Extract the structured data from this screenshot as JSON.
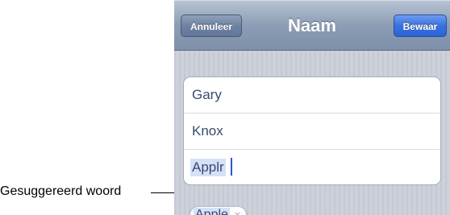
{
  "navbar": {
    "title": "Naam",
    "cancel_label": "Annuleer",
    "save_label": "Bewaar"
  },
  "form": {
    "rows": [
      {
        "value": "Gary"
      },
      {
        "value": "Knox"
      },
      {
        "value": "Applr"
      }
    ]
  },
  "suggestion": {
    "word": "Apple",
    "dismiss_glyph": "×"
  },
  "callout": {
    "label": "Gesuggereerd woord"
  },
  "colors": {
    "navbar": "#8d9db5",
    "save_button": "#3a71e0",
    "cancel_button": "#6f83a1",
    "text": "#374b6e",
    "highlight": "#d5e1f7"
  }
}
